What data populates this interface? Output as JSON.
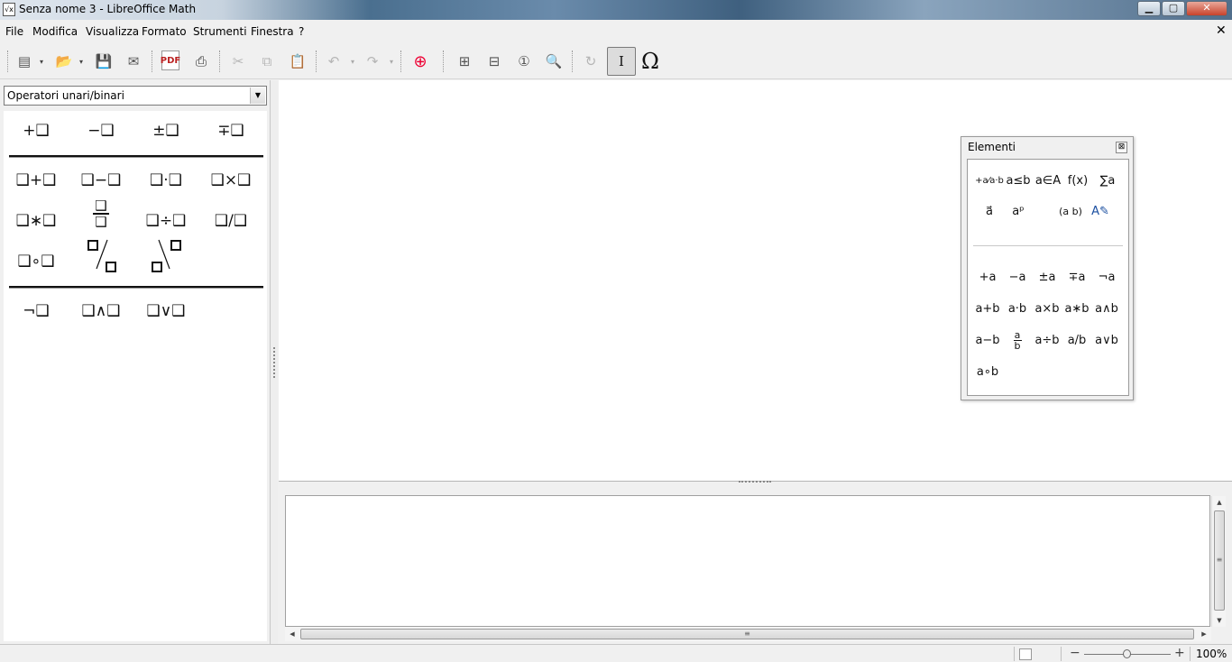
{
  "window": {
    "title": "Senza nome 3 - LibreOffice Math",
    "minimize": "▁",
    "maximize": "▢",
    "close": "✕"
  },
  "menu": {
    "items": [
      "File",
      "Modifica",
      "Visualizza",
      "Formato",
      "Strumenti",
      "Finestra",
      "?"
    ],
    "doc_close": "✕"
  },
  "toolbar": {
    "new_icon": "▤",
    "open_icon": "📂",
    "save_icon": "💾",
    "email_icon": "✉",
    "pdf_label": "PDF",
    "print_icon": "⎙",
    "cut_icon": "✂",
    "copy_icon": "⧉",
    "paste_icon": "📋",
    "undo_icon": "↶",
    "redo_icon": "↷",
    "help_icon": "⊕",
    "zoom_in_icon": "⊞",
    "zoom_out_icon": "⊟",
    "zoom_100_icon": "①",
    "show_all_icon": "🔍",
    "update_icon": "↻",
    "cursor_icon": "I",
    "symbols_icon": "Ω",
    "dropdown_glyph": "▾"
  },
  "elements_panel": {
    "category": "Operatori unari/binari",
    "dropdown_arrow": "▼",
    "unary": [
      "+❑",
      "−❑",
      "±❑",
      "∓❑"
    ],
    "binary_row1": [
      "❑+❑",
      "❑−❑",
      "❑·❑",
      "❑×❑"
    ],
    "binary_row2": [
      "❑∗❑",
      "❑/❑ frac",
      "❑÷❑",
      "❑/❑"
    ],
    "binary_row3": [
      "❑∘❑",
      "❑⁄❑",
      "❑∖❑"
    ],
    "logic": [
      "¬❑",
      "❑∧❑",
      "❑∨❑"
    ]
  },
  "elements_window": {
    "title": "Elementi",
    "close": "⊠",
    "categories": [
      "+a⁄a·b",
      "a≤b",
      "a∈A",
      "f(x)",
      "∑a",
      "a⃗",
      "aᵖ",
      "(a b)",
      "A✎"
    ],
    "ops": [
      "+a",
      "−a",
      "±a",
      "∓a",
      "¬a",
      "a+b",
      "a·b",
      "a×b",
      "a∗b",
      "a∧b",
      "a−b",
      "a/b frac",
      "a÷b",
      "a/b",
      "a∨b",
      "a∘b"
    ]
  },
  "status": {
    "zoom": "100%",
    "zoom_minus": "−",
    "zoom_plus": "+"
  },
  "scroll": {
    "up": "▲",
    "down": "▼",
    "left": "◀",
    "right": "▶",
    "grip": "≡"
  }
}
